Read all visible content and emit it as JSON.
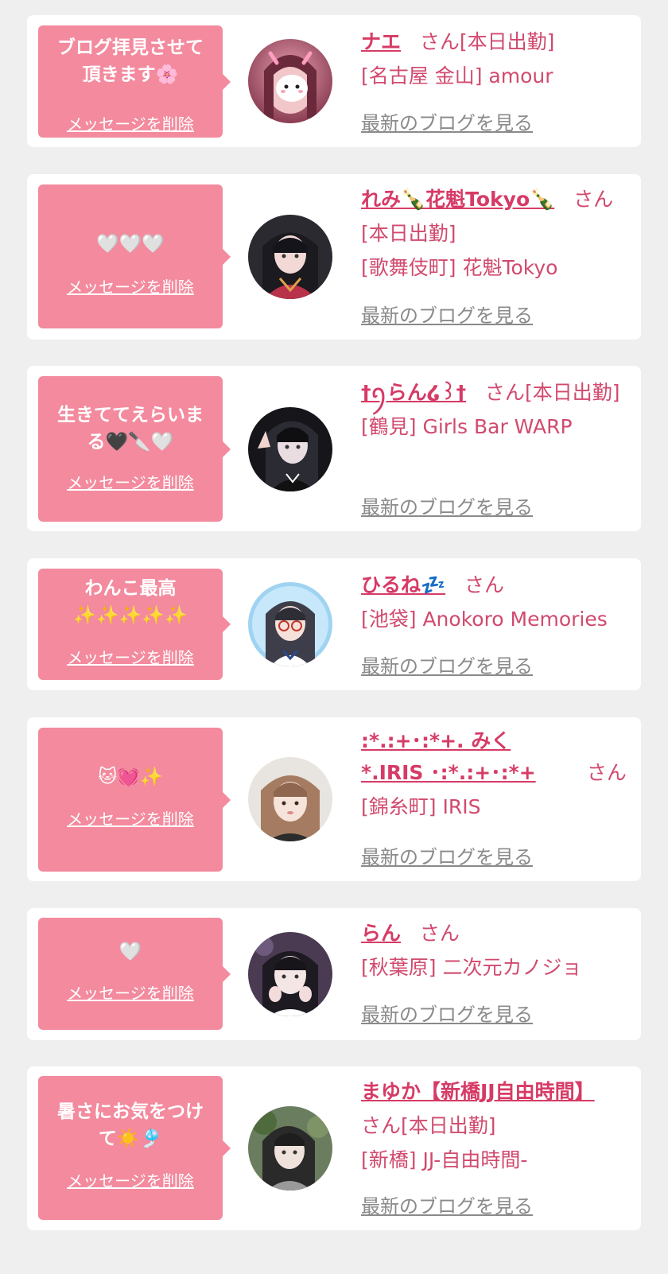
{
  "common": {
    "delete_label": "メッセージを削除",
    "blog_label": "最新のブログを見る",
    "san": "さん",
    "working_today": "[本日出勤]"
  },
  "colors": {
    "page_bg": "#efefef",
    "card_bg": "#ffffff",
    "bubble_pink": "#f38a9e",
    "name_pink": "#d63b66",
    "text_pink": "#d14a6e",
    "link_gray": "#8a8a8a"
  },
  "items": [
    {
      "message": "ブログ拝見させて\n頂きます🌸",
      "name": "ナエ",
      "shop": "[名古屋 金山] amour",
      "working": true
    },
    {
      "message": "🤍🤍🤍",
      "name": "れみ🍾花魁Tokyo🍾",
      "shop": "[歌舞伎町] 花魁Tokyo",
      "working": true
    },
    {
      "message": "生きててえらいま\nる🖤🔪🤍",
      "name": "†ꪆらん໒꒱†",
      "shop": "[鶴見] Girls Bar WARP",
      "working": true
    },
    {
      "message": "わんこ最高\n✨✨✨✨✨",
      "name": "ひるね💤",
      "shop": "[池袋] Anokoro Memories",
      "working": false
    },
    {
      "message": "🐱💓✨",
      "name": ":*.:+･:*+. みく*.IRIS ･:*.:+･:*+",
      "shop": "[錦糸町] IRIS",
      "working": false
    },
    {
      "message": "🤍",
      "name": "らん",
      "shop": "[秋葉原] 二次元カノジョ",
      "working": false
    },
    {
      "message": "暑さにお気をつけ\nて☀️🎐",
      "name": "まゆか【新橋JJ自由時間】",
      "shop": "[新橋] JJ-自由時間-",
      "working": true
    }
  ]
}
